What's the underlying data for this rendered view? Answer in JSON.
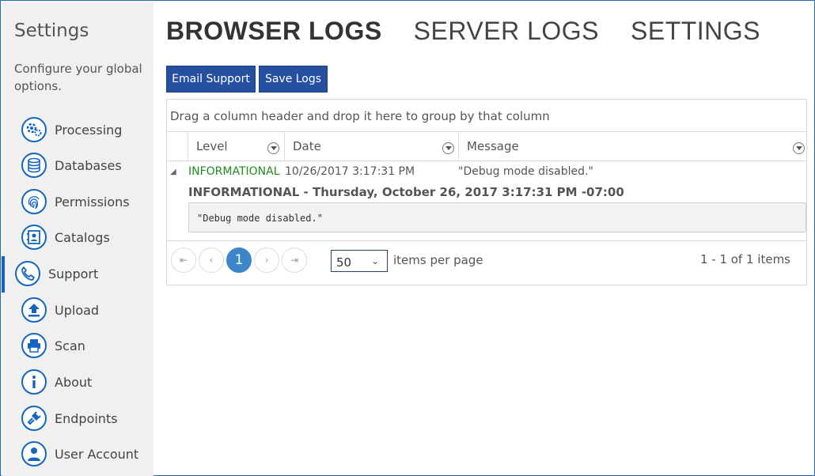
{
  "sidebar": {
    "title": "Settings",
    "description": "Configure your global options.",
    "items": [
      {
        "label": "Processing",
        "icon": "gears-icon"
      },
      {
        "label": "Databases",
        "icon": "database-icon"
      },
      {
        "label": "Permissions",
        "icon": "fingerprint-icon"
      },
      {
        "label": "Catalogs",
        "icon": "contact-card-icon"
      },
      {
        "label": "Support",
        "icon": "phone-icon",
        "active": true
      },
      {
        "label": "Upload",
        "icon": "upload-icon"
      },
      {
        "label": "Scan",
        "icon": "printer-icon"
      },
      {
        "label": "About",
        "icon": "info-icon"
      },
      {
        "label": "Endpoints",
        "icon": "plug-icon"
      },
      {
        "label": "User Account",
        "icon": "user-icon"
      }
    ]
  },
  "tabs": [
    {
      "label": "BROWSER LOGS",
      "active": true
    },
    {
      "label": "SERVER LOGS"
    },
    {
      "label": "SETTINGS"
    }
  ],
  "toolbar": {
    "email_label": "Email Support",
    "save_label": "Save Logs"
  },
  "grid": {
    "group_hint": "Drag a column header and drop it here to group by that column",
    "columns": [
      "Level",
      "Date",
      "Message"
    ],
    "rows": [
      {
        "level": "INFORMATIONAL",
        "date": "10/26/2017 3:17:31 PM",
        "message": "\"Debug mode disabled.\"",
        "detail_title": "INFORMATIONAL - Thursday, October 26, 2017 3:17:31 PM -07:00",
        "detail_body": "\"Debug mode disabled.\""
      }
    ]
  },
  "pager": {
    "current_page": "1",
    "page_size": "50",
    "page_size_label": "items per page",
    "info": "1 - 1 of 1 items"
  },
  "colors": {
    "accent": "#1565c0",
    "button": "#2550a0",
    "level_info": "#1e8c1e",
    "pager_current": "#3d87c9",
    "sidebar_bg": "#f0f0f0"
  }
}
